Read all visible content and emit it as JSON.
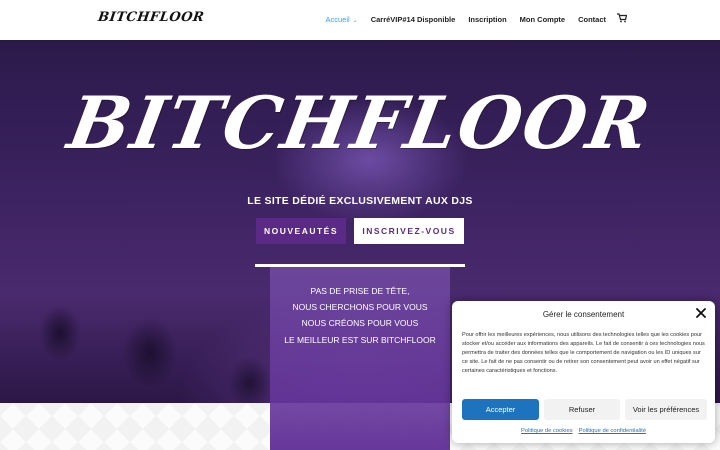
{
  "header": {
    "logo_text": "BITCHFLOOR",
    "nav": [
      {
        "label": "Accueil"
      },
      {
        "label": "CarréVIP#14 Disponible"
      },
      {
        "label": "Inscription"
      },
      {
        "label": "Mon Compte"
      },
      {
        "label": "Contact"
      }
    ],
    "cart_icon": "cart-icon"
  },
  "hero": {
    "title": "BITCHFLOOR",
    "subtitle": "LE SITE DÉDIÉ EXCLUSIVEMENT AUX DJS",
    "btn_news": "NOUVEAUTÉS",
    "btn_signup": "INSCRIVEZ-VOUS"
  },
  "panel": {
    "lines": [
      "PAS DE PRISE DE TÊTE,",
      "NOUS CHERCHONS POUR VOUS",
      "NOUS CRÉONS POUR VOUS",
      "LE MEILLEUR EST SUR BITCHFLOOR"
    ]
  },
  "cookie": {
    "title": "Gérer le consentement",
    "text": "Pour offrir les meilleures expériences, nous utilisons des technologies telles que les cookies pour stocker et/ou accéder aux informations des appareils. Le fait de consentir à ces technologies nous permettra de traiter des données telles que le comportement de navigation ou les ID uniques sur ce site. Le fait de ne pas consentir ou de retirer son consentement peut avoir un effet négatif sur certaines caractéristiques et fonctions.",
    "accept": "Accepter",
    "refuse": "Refuser",
    "prefs": "Voir les préférences",
    "link_cookies": "Politique de cookies",
    "link_privacy": "Politique de confidentialité"
  },
  "colors": {
    "accent_blue": "#2ea3f2",
    "brand_purple": "#5b2a86",
    "consent_blue": "#1e73be"
  }
}
